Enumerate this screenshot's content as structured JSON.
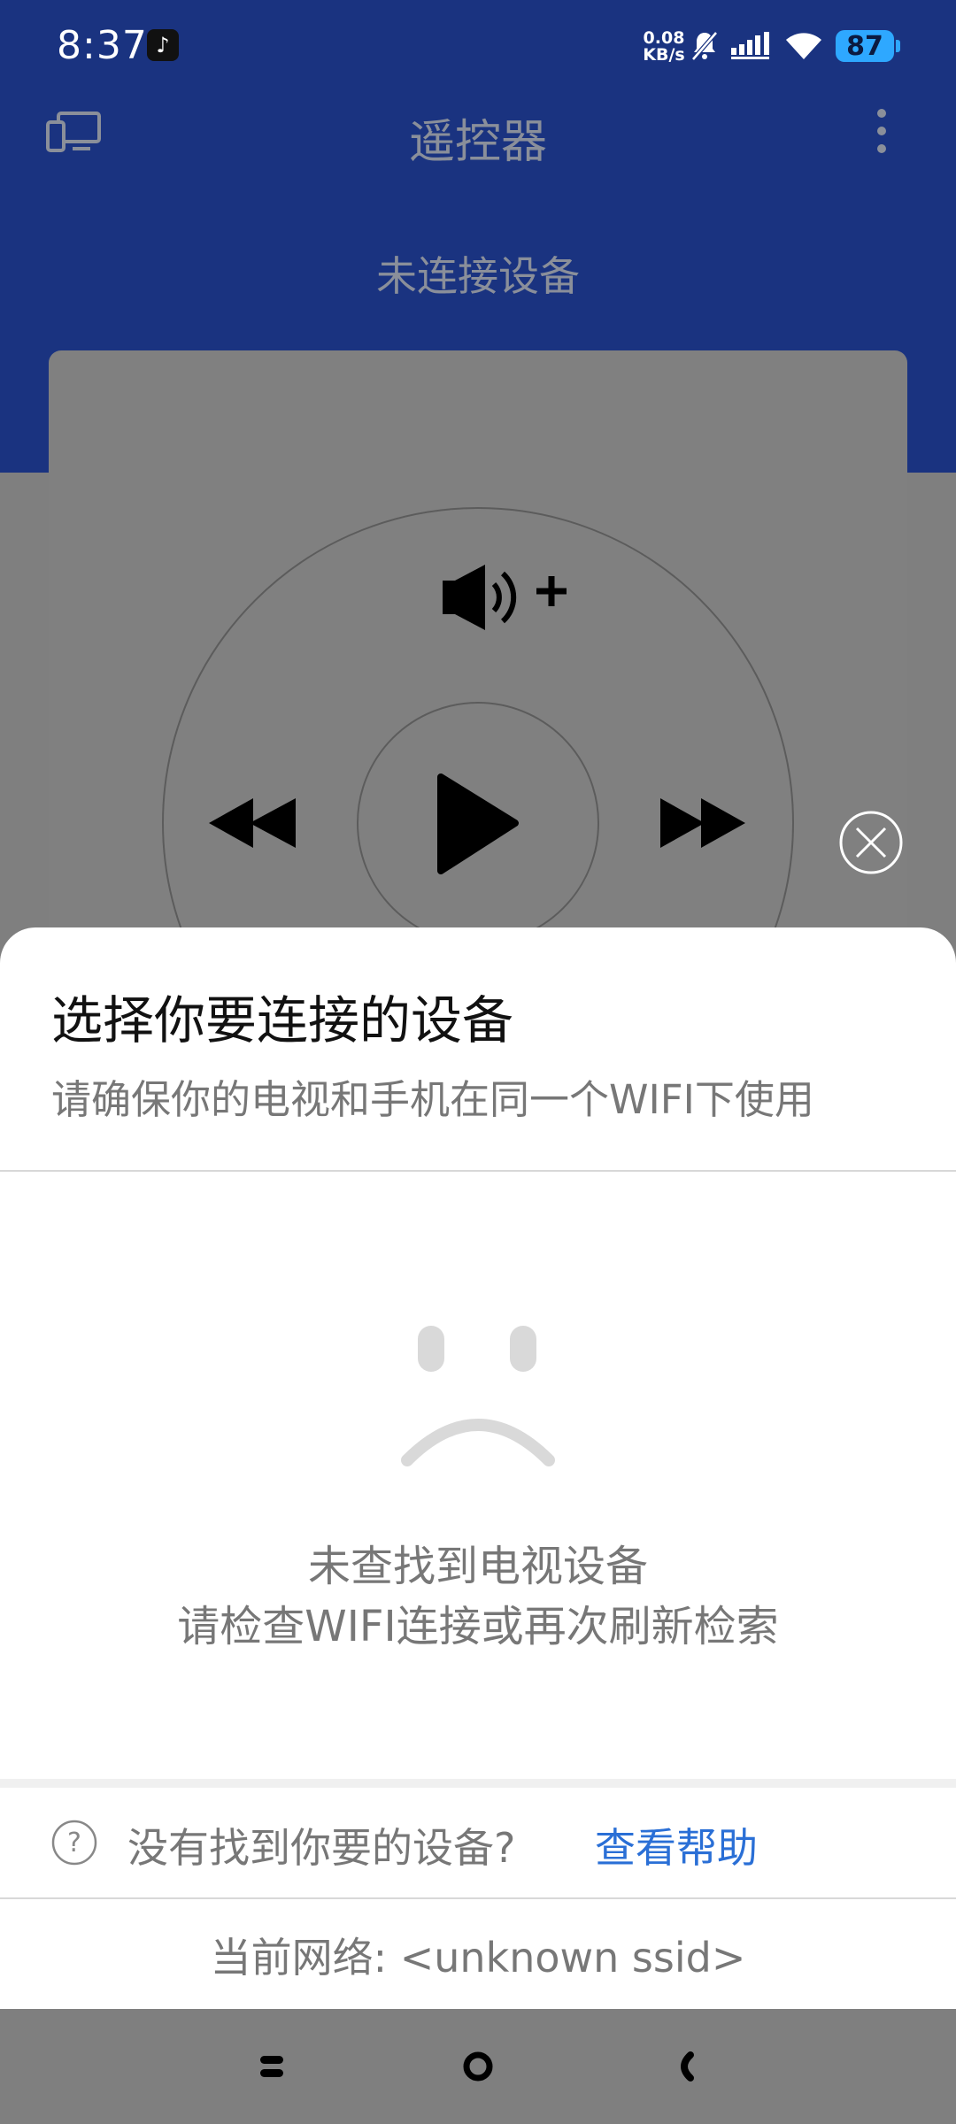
{
  "status_bar": {
    "time": "8:37",
    "net_speed_value": "0.08",
    "net_speed_unit": "KB/s",
    "battery": "87"
  },
  "app": {
    "title": "遥控器",
    "connection_status": "未连接设备"
  },
  "sheet": {
    "title": "选择你要连接的设备",
    "subtitle": "请确保你的电视和手机在同一个WIFI下使用",
    "empty_line1": "未查找到电视设备",
    "empty_line2": "请检查WIFI连接或再次刷新检索",
    "help_question": "没有找到你要的设备?",
    "help_link": "查看帮助",
    "network": "当前网络: <unknown ssid>"
  },
  "colors": {
    "header_blue": "#1a3380",
    "link_blue": "#2a6fd6",
    "battery_blue": "#2ea8ff"
  }
}
